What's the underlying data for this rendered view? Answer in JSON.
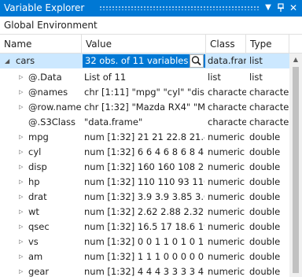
{
  "window": {
    "title": "Variable Explorer"
  },
  "icons": {
    "dropdown": "chevron-down-icon",
    "pin": "pin-icon",
    "close": "close-icon",
    "inspect": "magnifier-icon",
    "scroll_up": "chevron-up-icon"
  },
  "environment": {
    "label": "Global Environment"
  },
  "columns": {
    "name": "Name",
    "value": "Value",
    "class": "Class",
    "type": "Type"
  },
  "rows": [
    {
      "name": "cars",
      "value": "32 obs. of  11 variables",
      "class": "data.frar",
      "type": "list"
    },
    {
      "name": "@.Data",
      "value": "List of 11",
      "class": "list",
      "type": "list"
    },
    {
      "name": "@names",
      "value": "chr [1:11] \"mpg\" \"cyl\" \"disp\" \"",
      "class": "characte",
      "type": "characte"
    },
    {
      "name": "@row.names",
      "value": "chr [1:32] \"Mazda RX4\" \"Mazc",
      "class": "characte",
      "type": "characte"
    },
    {
      "name": "@.S3Class",
      "value": "\"data.frame\"",
      "class": "characte",
      "type": "characte"
    },
    {
      "name": "mpg",
      "value": "num [1:32] 21 21 22.8 21.4 18.7",
      "class": "numeric",
      "type": "double"
    },
    {
      "name": "cyl",
      "value": "num [1:32] 6 6 4 6 8 6 8 4 4 6 6 8",
      "class": "numeric",
      "type": "double"
    },
    {
      "name": "disp",
      "value": "num [1:32] 160 160 108 258 360",
      "class": "numeric",
      "type": "double"
    },
    {
      "name": "hp",
      "value": "num [1:32] 110 110 93 110 175",
      "class": "numeric",
      "type": "double"
    },
    {
      "name": "drat",
      "value": "num [1:32] 3.9 3.9 3.85 3.08 3.",
      "class": "numeric",
      "type": "double"
    },
    {
      "name": "wt",
      "value": "num [1:32] 2.62 2.88 2.32 3.21",
      "class": "numeric",
      "type": "double"
    },
    {
      "name": "qsec",
      "value": "num [1:32] 16.5 17 18.6 19.4 17",
      "class": "numeric",
      "type": "double"
    },
    {
      "name": "vs",
      "value": "num [1:32] 0 0 1 1 0 1 0 1 1 1 1",
      "class": "numeric",
      "type": "double"
    },
    {
      "name": "am",
      "value": "num [1:32] 1 1 1 0 0 0 0 0 0 0 0",
      "class": "numeric",
      "type": "double"
    },
    {
      "name": "gear",
      "value": "num [1:32] 4 4 4 3 3 3 3 4 4 4 4",
      "class": "numeric",
      "type": "double"
    }
  ]
}
